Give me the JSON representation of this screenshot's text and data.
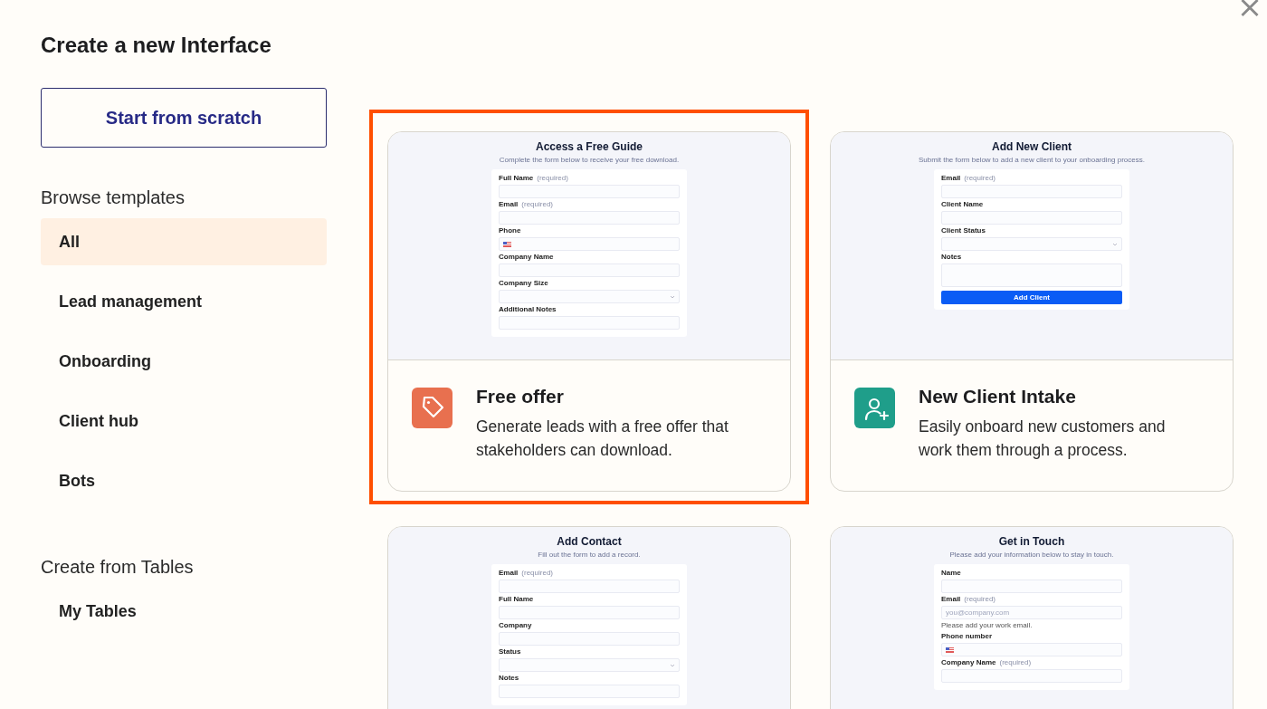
{
  "title": "Create a new Interface",
  "sidebar": {
    "start_button": "Start from scratch",
    "sections": [
      {
        "heading": "Browse templates",
        "items": [
          {
            "label": "All",
            "selected": true
          },
          {
            "label": "Lead management",
            "selected": false
          },
          {
            "label": "Onboarding",
            "selected": false
          },
          {
            "label": "Client hub",
            "selected": false
          },
          {
            "label": "Bots",
            "selected": false
          }
        ]
      },
      {
        "heading": "Create from Tables",
        "items": [
          {
            "label": "My Tables",
            "selected": false
          }
        ]
      }
    ]
  },
  "templates": [
    {
      "selected": true,
      "name": "Free offer",
      "description": "Generate leads with a free offer that stakeholders can download.",
      "color": "#e8704f",
      "preview": {
        "title": "Access a Free Guide",
        "subtitle": "Complete the form below to receive your free download.",
        "fields": [
          {
            "kind": "text",
            "label": "Full Name",
            "hint": "(required)"
          },
          {
            "kind": "text",
            "label": "Email",
            "hint": "(required)"
          },
          {
            "kind": "phone",
            "label": "Phone"
          },
          {
            "kind": "text",
            "label": "Company Name"
          },
          {
            "kind": "select",
            "label": "Company Size"
          },
          {
            "kind": "text",
            "label": "Additional Notes"
          }
        ]
      }
    },
    {
      "selected": false,
      "name": "New Client Intake",
      "description": "Easily onboard new customers and work them through a process.",
      "color": "#1f9e8a",
      "preview": {
        "title": "Add New Client",
        "subtitle": "Submit the form below to add a new client to your onboarding process.",
        "fields": [
          {
            "kind": "text",
            "label": "Email",
            "hint": "(required)"
          },
          {
            "kind": "text",
            "label": "Client Name"
          },
          {
            "kind": "select",
            "label": "Client Status"
          },
          {
            "kind": "textarea",
            "label": "Notes"
          },
          {
            "kind": "button",
            "label": "Add Client"
          }
        ]
      }
    },
    {
      "selected": false,
      "preview": {
        "title": "Add Contact",
        "subtitle": "Fill out the form to add a record.",
        "fields": [
          {
            "kind": "text",
            "label": "Email",
            "hint": "(required)"
          },
          {
            "kind": "text",
            "label": "Full Name"
          },
          {
            "kind": "text",
            "label": "Company"
          },
          {
            "kind": "select",
            "label": "Status"
          },
          {
            "kind": "text",
            "label": "Notes"
          }
        ]
      }
    },
    {
      "selected": false,
      "preview": {
        "title": "Get in Touch",
        "subtitle": "Please add your information below to stay in touch.",
        "fields": [
          {
            "kind": "text",
            "label": "Name"
          },
          {
            "kind": "text",
            "label": "Email",
            "hint": "(required)",
            "placeholder": "you@company.com",
            "help": "Please add your work email."
          },
          {
            "kind": "phone",
            "label": "Phone number"
          },
          {
            "kind": "text",
            "label": "Company Name",
            "hint": "(required)"
          }
        ]
      }
    }
  ]
}
